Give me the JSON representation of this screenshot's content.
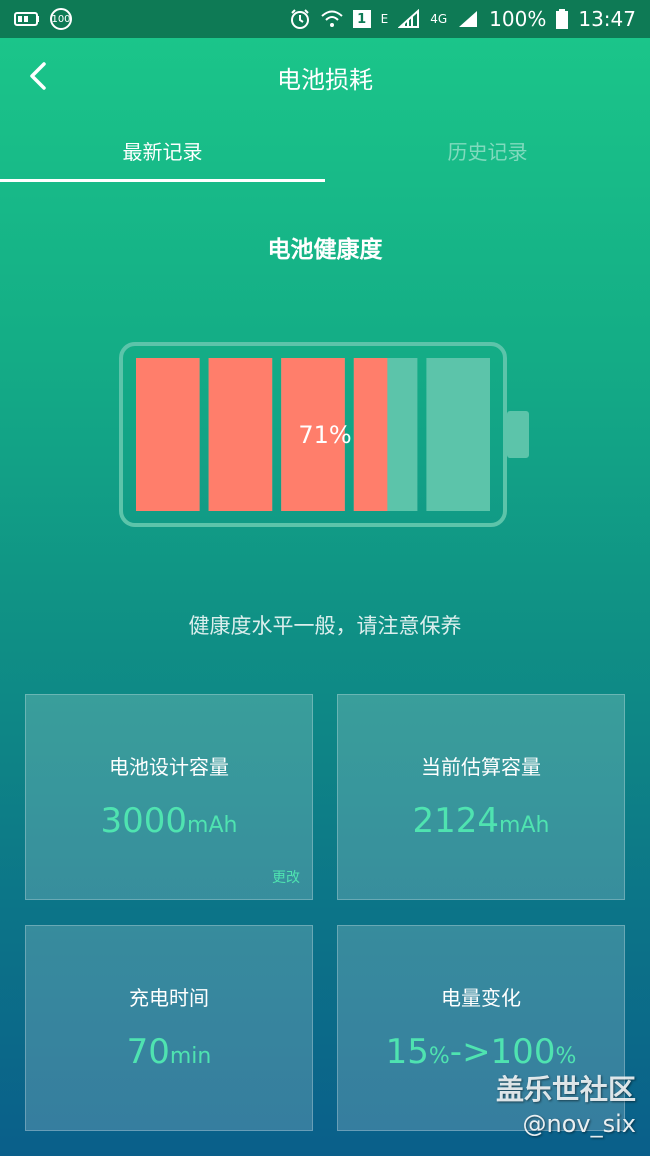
{
  "status_bar": {
    "left_icons": [
      "battery-saver-icon",
      "badge-100-icon"
    ],
    "badge_text": "100",
    "right_icons": [
      "alarm-icon",
      "wifi-icon",
      "sim1-icon",
      "signal-icon",
      "signal-icon-2",
      "battery-icon"
    ],
    "sim_label": "1",
    "network_e": "E",
    "network_4g": "4G",
    "battery_percent": "100%",
    "time": "13:47"
  },
  "header": {
    "title": "电池损耗",
    "back_icon": "chevron-left-icon"
  },
  "tabs": [
    {
      "label": "最新记录",
      "active": true
    },
    {
      "label": "历史记录",
      "active": false
    }
  ],
  "health": {
    "title": "电池健康度",
    "percent_label": "71%",
    "percent_value": 0.71,
    "message": "健康度水平一般，请注意保养",
    "fill_color": "#ff7e6b",
    "empty_color": "#5cc4aa"
  },
  "cards": [
    {
      "title": "电池设计容量",
      "value": "3000",
      "unit": "mAh",
      "link": "更改"
    },
    {
      "title": "当前估算容量",
      "value": "2124",
      "unit": "mAh"
    },
    {
      "title": "充电时间",
      "value": "70",
      "unit": "min"
    },
    {
      "title": "电量变化",
      "value_parts": [
        "15",
        "%",
        "->100",
        "%"
      ]
    }
  ],
  "watermark": {
    "line1": "盖乐世社区",
    "line2": "@nov_six"
  }
}
